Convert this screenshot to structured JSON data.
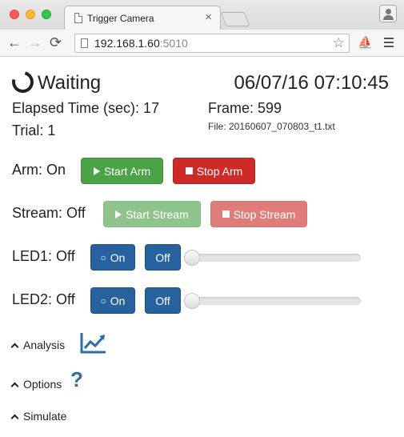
{
  "browser": {
    "tab_title": "Trigger Camera",
    "tab_close": "×",
    "url_host": "192.168.1.60",
    "url_port": ":5010",
    "star": "☆",
    "nav_back": "←",
    "nav_forward": "→",
    "nav_reload": "⟳",
    "extension": "⛵"
  },
  "status": {
    "state": "Waiting",
    "datetime": "06/07/16 07:10:45"
  },
  "info": {
    "elapsed": "Elapsed Time (sec): 17",
    "frame": "Frame: 599",
    "trial": "Trial: 1",
    "file": "File: 20160607_070803_t1.txt"
  },
  "arm": {
    "label": "Arm: On",
    "start": "Start Arm",
    "stop": "Stop Arm"
  },
  "stream": {
    "label": "Stream: Off",
    "start": "Start Stream",
    "stop": "Stop Stream"
  },
  "led1": {
    "label": "LED1: Off",
    "on": "On",
    "off": "Off",
    "level": 0
  },
  "led2": {
    "label": "LED2: Off",
    "on": "On",
    "off": "Off",
    "level": 0
  },
  "sections": {
    "analysis": "Analysis",
    "options": "Options",
    "simulate": "Simulate",
    "help_glyph": "?"
  },
  "colors": {
    "start_green": "#4aa447",
    "stop_red": "#cc2b27",
    "led_blue": "#28629e",
    "icon_blue": "#2e6da4"
  },
  "icons": [
    "spinner-icon",
    "play-icon",
    "stop-icon",
    "bulb-icon",
    "chevron-up-icon",
    "chart-line-icon",
    "question-icon"
  ]
}
